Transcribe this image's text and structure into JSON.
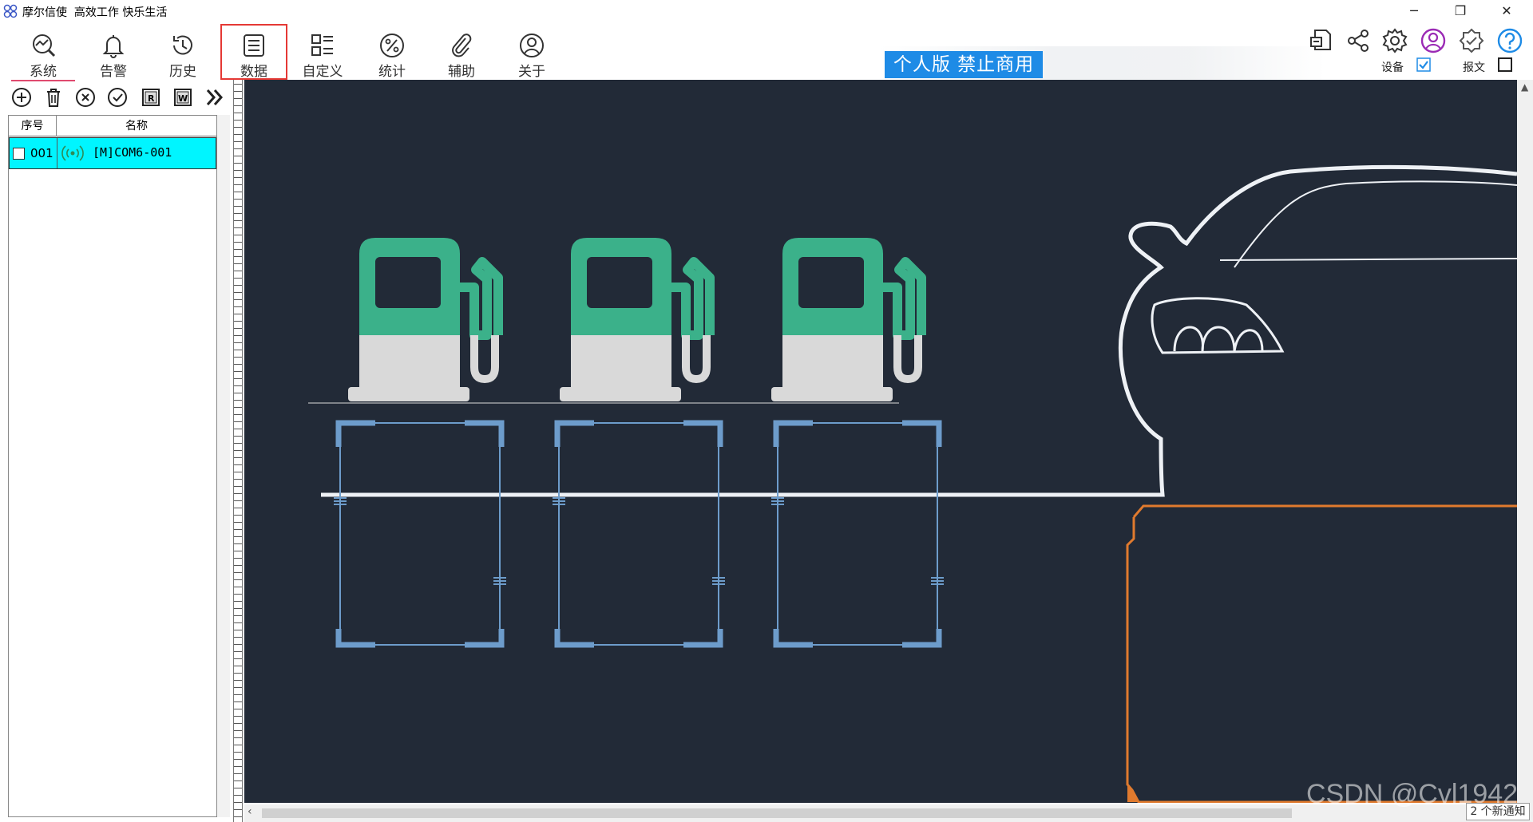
{
  "app": {
    "title": "摩尔信使  高效工作 快乐生活",
    "minimize": "─",
    "restore": "❐",
    "close": "✕"
  },
  "ribbon": {
    "tabs": [
      {
        "label": "系统",
        "icon": "chart-search-icon"
      },
      {
        "label": "告警",
        "icon": "bell-icon"
      },
      {
        "label": "历史",
        "icon": "history-clock-icon"
      },
      {
        "label": "数据",
        "icon": "document-lines-icon"
      },
      {
        "label": "自定义",
        "icon": "custom-grid-icon"
      },
      {
        "label": "统计",
        "icon": "percent-icon"
      },
      {
        "label": "辅助",
        "icon": "paperclip-icon"
      },
      {
        "label": "关于",
        "icon": "user-circle-icon"
      }
    ],
    "active_tab": "系统",
    "highlighted_tab": "数据",
    "banner": "个人版  禁止商用",
    "right_icons": [
      "report-doc-icon",
      "share-icon",
      "settings-gear-icon",
      "account-icon",
      "verified-badge-icon",
      "help-icon"
    ],
    "device_label": "设备",
    "device_checked": true,
    "message_label": "报文",
    "message_checked": false
  },
  "left_toolbar": {
    "buttons": [
      "add-icon",
      "delete-icon",
      "cancel-icon",
      "confirm-icon",
      "read-icon",
      "write-icon",
      "expand-icon"
    ]
  },
  "device_list": {
    "columns": [
      "序号",
      "名称"
    ],
    "rows": [
      {
        "index": "001",
        "name": "[M]COM6-001",
        "icon": "signal-icon",
        "selected": true,
        "checked": false
      }
    ]
  },
  "canvas": {
    "background": "#222a37",
    "pump_top_color": "#3bb18a",
    "pump_bottom_color": "#d9d9d9",
    "panel_color": "#6d9ccb",
    "orange_panel_color": "#e07a2e",
    "pumps": 3,
    "panels": 3
  },
  "watermark": "CSDN @Cvl1942",
  "notice": "2 个新通知"
}
